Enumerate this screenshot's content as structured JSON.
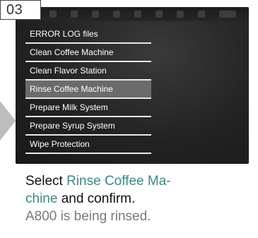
{
  "step": {
    "number": "03"
  },
  "device_screen": {
    "menu_items": [
      {
        "label": "ERROR LOG files",
        "selected": false
      },
      {
        "label": "Clean Coffee Machine",
        "selected": false
      },
      {
        "label": "Clean Flavor Station",
        "selected": false
      },
      {
        "label": "Rinse Coffee Machine",
        "selected": true
      },
      {
        "label": "Prepare Milk System",
        "selected": false
      },
      {
        "label": "Prepare Syrup System",
        "selected": false
      },
      {
        "label": "Wipe Protection",
        "selected": false
      }
    ]
  },
  "instruction": {
    "prefix": "Select ",
    "highlight_line1": "Rinse Coffee Ma-",
    "highlight_line2": "chine",
    "suffix": " and confirm.",
    "result": "A800 is being rinsed."
  },
  "colors": {
    "highlight": "#3a8a86",
    "result_text": "#7a7a7a",
    "selected_row": "#6b6b6b"
  }
}
